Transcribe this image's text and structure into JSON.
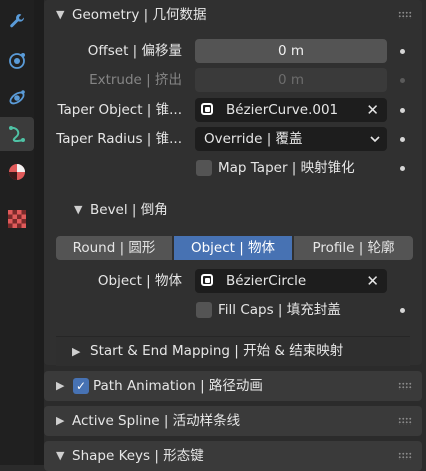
{
  "sidebar": {
    "items": [
      {
        "icon": "wrench-icon",
        "color": "#5a9bd8"
      },
      {
        "icon": "particles-icon",
        "color": "#5a9bd8"
      },
      {
        "icon": "physics-icon",
        "color": "#5a9bd8"
      },
      {
        "icon": "curve-data-icon",
        "color": "#4fc2a5",
        "active": true
      },
      {
        "icon": "material-icon",
        "color": "#e05a5a"
      },
      {
        "icon": "texture-icon",
        "color": "#d04040"
      }
    ]
  },
  "geometry": {
    "title": "Geometry | 几何数据",
    "offset_label": "Offset | 偏移量",
    "offset_value": "0 m",
    "extrude_label": "Extrude | 挤出",
    "extrude_value": "0 m",
    "taper_object_label": "Taper Object | 锥...",
    "taper_object_value": "BézierCurve.001",
    "taper_radius_label": "Taper Radius | 锥...",
    "taper_radius_value": "Override | 覆盖",
    "map_taper_label": "Map Taper | 映射锥化",
    "map_taper_checked": false
  },
  "bevel": {
    "title": "Bevel | 倒角",
    "modes": [
      "Round | 圆形",
      "Object | 物体",
      "Profile | 轮廓"
    ],
    "active_mode": "Object | 物体",
    "object_label": "Object | 物体",
    "object_value": "BézierCircle",
    "fill_caps_label": "Fill Caps | 填充封盖",
    "fill_caps_checked": false
  },
  "start_end_mapping": {
    "title": "Start & End Mapping | 开始 & 结束映射"
  },
  "path_animation": {
    "title": "Path Animation | 路径动画",
    "enabled": true
  },
  "active_spline": {
    "title": "Active Spline | 活动样条线"
  },
  "shape_keys": {
    "title": "Shape Keys | 形态键"
  },
  "colors": {
    "accent": "#4772b3",
    "background": "#2b2b2b",
    "field": "#545454",
    "object_field": "#1d1d1d"
  }
}
